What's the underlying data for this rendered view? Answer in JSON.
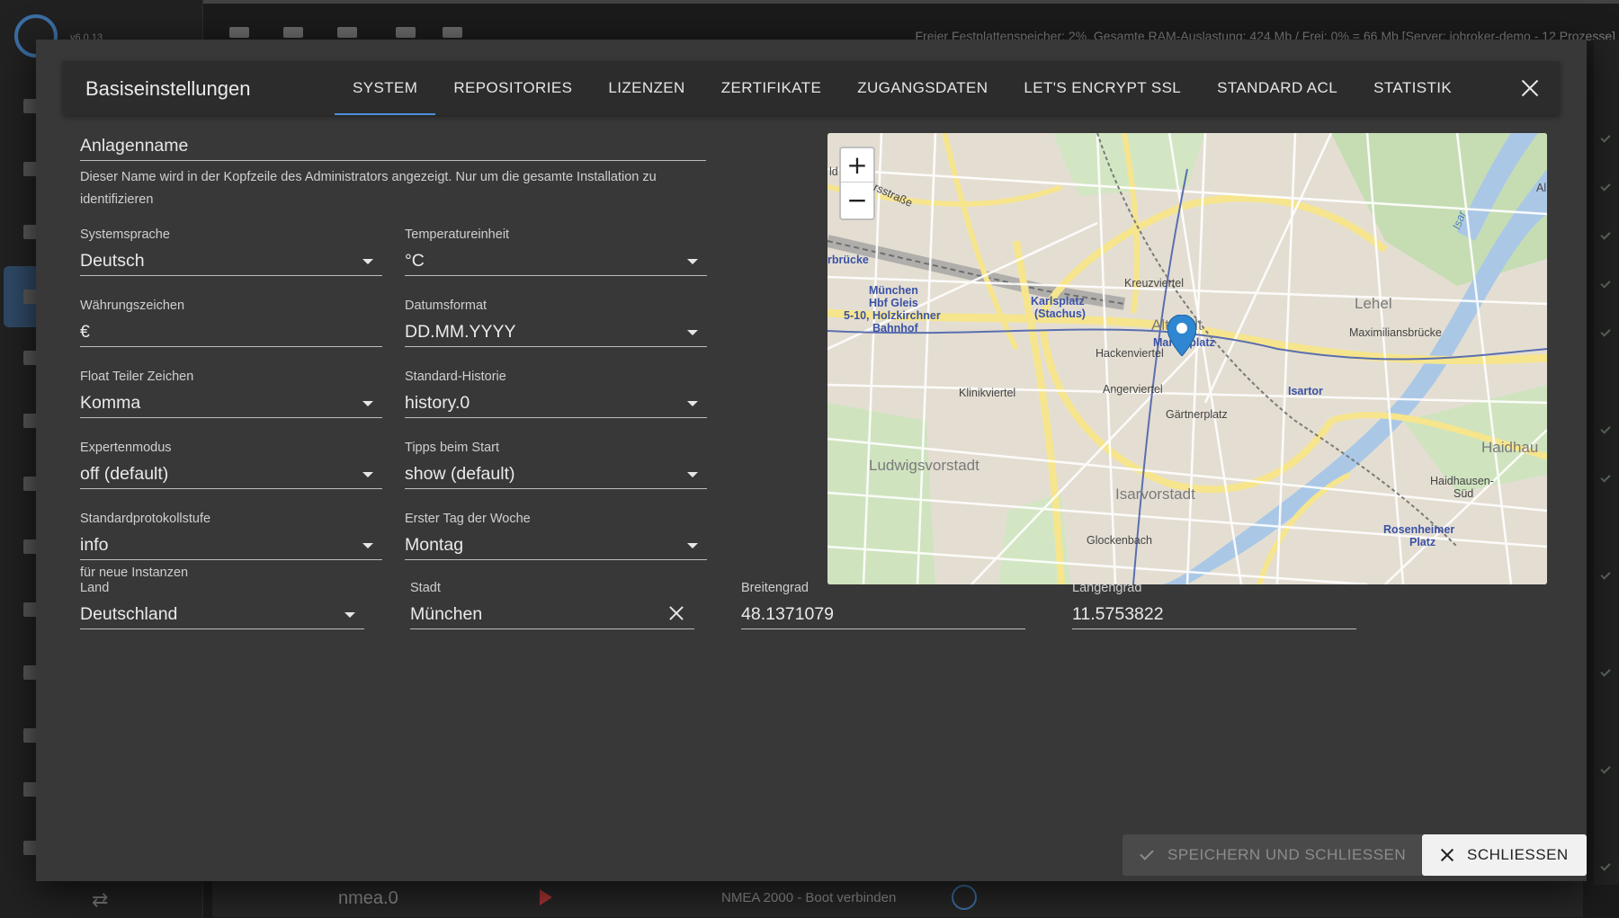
{
  "background": {
    "version": "v6.0.13",
    "status_text": "Freier Festplattenspeicher: 2%, Gesamte RAM-Auslastung: 424 Mb / Frei: 0% = 66 Mb [Server: iobroker-demo - 12 Prozesse]",
    "instance_row": {
      "name": "nmea.0",
      "description": "NMEA 2000 - Boot verbinden"
    }
  },
  "dialog": {
    "title": "Basiseinstellungen",
    "tabs": [
      {
        "label": "SYSTEM",
        "active": true
      },
      {
        "label": "REPOSITORIES"
      },
      {
        "label": "LIZENZEN"
      },
      {
        "label": "ZERTIFIKATE"
      },
      {
        "label": "ZUGANGSDATEN"
      },
      {
        "label": "LET'S ENCRYPT SSL"
      },
      {
        "label": "STANDARD ACL"
      },
      {
        "label": "STATISTIK"
      }
    ]
  },
  "form": {
    "system_name": {
      "placeholder": "Anlagenname",
      "helper": "Dieser Name wird in der Kopfzeile des Administrators angezeigt. Nur um die gesamte Installation zu identifizieren"
    },
    "language": {
      "label": "Systemsprache",
      "value": "Deutsch"
    },
    "temperature": {
      "label": "Temperatureinheit",
      "value": "°C"
    },
    "currency": {
      "label": "Währungszeichen",
      "value": "€"
    },
    "date_format": {
      "label": "Datumsformat",
      "value": "DD.MM.YYYY"
    },
    "float_separator": {
      "label": "Float Teiler Zeichen",
      "value": "Komma"
    },
    "default_history": {
      "label": "Standard-Historie",
      "value": "history.0"
    },
    "expert_mode": {
      "label": "Expertenmodus",
      "value": "off (default)"
    },
    "tips_on_start": {
      "label": "Tipps beim Start",
      "value": "show (default)"
    },
    "log_level": {
      "label": "Standardprotokollstufe",
      "value": "info",
      "helper": "für neue Instanzen"
    },
    "first_day": {
      "label": "Erster Tag der Woche",
      "value": "Montag"
    },
    "country": {
      "label": "Land",
      "value": "Deutschland"
    },
    "city": {
      "label": "Stadt",
      "value": "München"
    },
    "latitude": {
      "label": "Breitengrad",
      "value": "48.1371079"
    },
    "longitude": {
      "label": "Längengrad",
      "value": "11.5753822"
    }
  },
  "map": {
    "zoom_in": "+",
    "zoom_out": "−",
    "labels": {
      "kreuzviertel": "Kreuzviertel",
      "karlsplatz": "Karlsplatz",
      "stachus": "(Stachus)",
      "altstadt": "Altstadt",
      "marienplatz": "Marienplatz",
      "lehel": "Lehel",
      "maximiliansbruecke": "Maximiliansbrücke",
      "hackenviertel": "Hackenviertel",
      "angerviertel": "Angerviertel",
      "klinikviertel": "Klinikviertel",
      "isartor": "Isartor",
      "gaertnerplatz": "Gärtnerplatz",
      "ludwigsvorstadt": "Ludwigsvorstadt",
      "isarvorstadt": "Isarvorstadt",
      "glockenbach": "Glockenbach",
      "haidhausen": "Haidhau",
      "haidhausen_sued": "Haidhausen-",
      "sued": "Süd",
      "rosenheimer": "Rosenheimer",
      "platz": "Platz",
      "hbf1": "München",
      "hbf2": "Hbf Gleis",
      "hbf3": "5-10, Holzkirchner",
      "hbf4": "Bahnhof",
      "bruecke": "rbrücke",
      "strasse": "rsstraße",
      "isar": "Isar",
      "al": "Al",
      "id": "ld"
    }
  },
  "footer": {
    "save_label": "SPEICHERN UND SCHLIESSEN",
    "close_label": "SCHLIESSEN"
  }
}
